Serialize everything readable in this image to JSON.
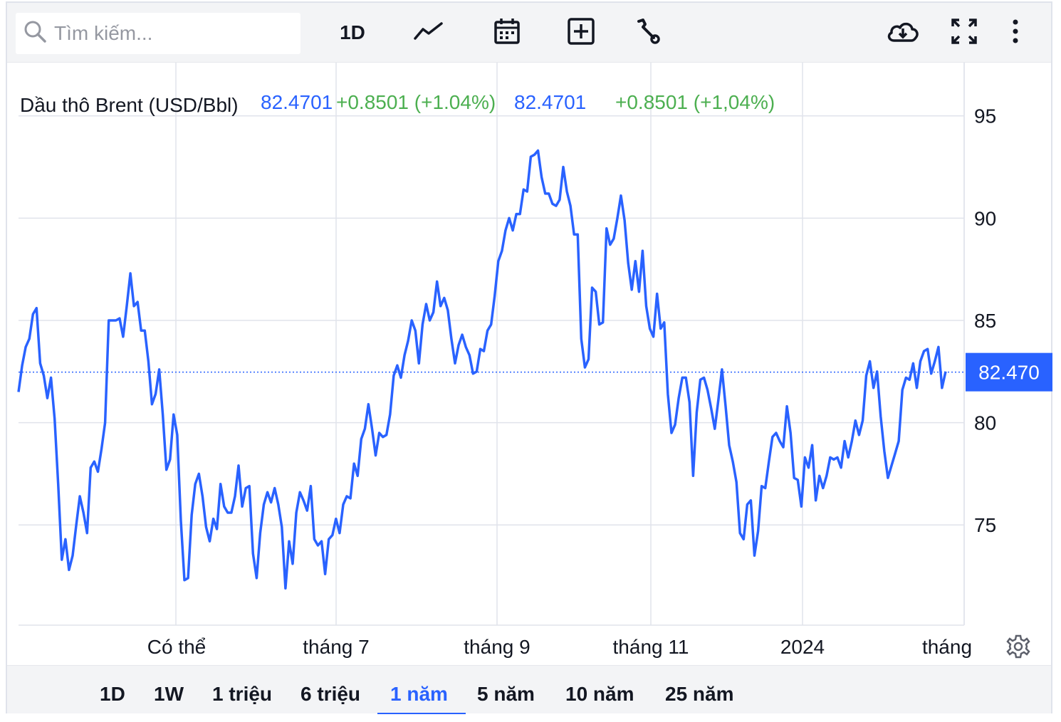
{
  "toolbar": {
    "search_placeholder": "Tìm kiếm...",
    "interval_label": "1D",
    "icons": [
      "search-icon",
      "line-chart-icon",
      "calendar-icon",
      "add-indicator-icon",
      "wrench-icon",
      "cloud-download-icon",
      "fullscreen-icon",
      "more-vertical-icon"
    ]
  },
  "legend": {
    "symbol": "Dầu thô Brent (USD/Bbl)",
    "value": "82.4701",
    "change": "+0.8501 (+1.04%)",
    "value2": "82.4701",
    "change2": "+0.8501 (+1,04%)"
  },
  "colors": {
    "line": "#2962ff",
    "positive": "#4caf50",
    "last_price_bg": "#2962ff"
  },
  "range_buttons": [
    "1D",
    "1W",
    "1 triệu",
    "6 triệu",
    "1 năm",
    "5 năm",
    "10 năm",
    "25 năm"
  ],
  "active_range": "1 năm",
  "chart_data": {
    "type": "line",
    "series_color": "#2962ff",
    "y_ticks": [
      75,
      80,
      85,
      90,
      95
    ],
    "ylim": [
      70.1,
      97.6
    ],
    "x_tick_labels": [
      "Có thể",
      "tháng 7",
      "tháng 9",
      "tháng 11",
      "2024",
      "tháng"
    ],
    "last_price_label": "82.470",
    "last_value": 82.47,
    "grid": true,
    "values": [
      81.5,
      82.8,
      83.7,
      84.1,
      85.3,
      85.6,
      82.9,
      82.3,
      81.2,
      82.2,
      80.2,
      77.0,
      73.3,
      74.3,
      72.8,
      73.5,
      75.0,
      76.4,
      75.6,
      74.6,
      77.8,
      78.1,
      77.6,
      78.7,
      80.0,
      85.0,
      85.0,
      85.0,
      85.1,
      84.2,
      85.7,
      87.3,
      85.7,
      85.9,
      84.5,
      84.5,
      83.0,
      80.9,
      81.4,
      82.6,
      80.4,
      77.7,
      78.2,
      80.4,
      79.4,
      75.2,
      72.3,
      72.4,
      75.5,
      77.0,
      77.5,
      76.4,
      74.9,
      74.2,
      75.3,
      74.8,
      77.0,
      75.9,
      75.6,
      75.6,
      76.4,
      77.9,
      75.9,
      76.8,
      76.9,
      73.6,
      72.4,
      74.6,
      76.0,
      76.6,
      76.1,
      76.8,
      76.0,
      74.9,
      71.9,
      74.2,
      73.1,
      75.6,
      76.6,
      76.2,
      75.7,
      76.9,
      74.3,
      74.0,
      74.2,
      72.6,
      74.3,
      74.5,
      75.3,
      74.6,
      76.0,
      76.4,
      76.3,
      78.0,
      77.4,
      79.2,
      79.7,
      80.9,
      79.7,
      78.4,
      79.5,
      79.3,
      79.4,
      80.4,
      82.3,
      82.8,
      82.2,
      83.3,
      84.0,
      85.0,
      84.5,
      82.9,
      84.8,
      85.8,
      85.0,
      85.4,
      86.9,
      85.7,
      86.1,
      85.5,
      84.1,
      82.9,
      83.8,
      84.3,
      83.7,
      83.3,
      82.4,
      82.5,
      83.6,
      83.5,
      84.5,
      84.8,
      86.2,
      87.9,
      88.4,
      89.4,
      90.0,
      89.4,
      90.2,
      90.2,
      91.4,
      91.3,
      93.0,
      93.1,
      93.3,
      92.0,
      91.2,
      91.2,
      90.7,
      90.6,
      90.9,
      92.5,
      91.3,
      90.6,
      89.2,
      89.2,
      84.1,
      82.7,
      83.1,
      86.6,
      86.4,
      84.8,
      84.9,
      89.5,
      88.7,
      89.0,
      90.0,
      91.1,
      89.9,
      87.8,
      86.5,
      87.9,
      86.4,
      88.4,
      85.7,
      84.6,
      84.2,
      86.3,
      84.6,
      84.9,
      81.4,
      79.5,
      79.9,
      81.2,
      82.2,
      82.2,
      81.0,
      77.4,
      80.5,
      82.1,
      82.2,
      81.6,
      80.7,
      79.7,
      81.1,
      82.6,
      80.8,
      78.9,
      78.1,
      77.1,
      74.6,
      74.3,
      76.0,
      76.2,
      73.5,
      74.7,
      76.9,
      76.8,
      78.1,
      79.3,
      79.5,
      79.1,
      78.8,
      80.8,
      79.5,
      77.3,
      77.2,
      75.9,
      78.3,
      77.8,
      78.9,
      76.2,
      77.4,
      76.8,
      77.4,
      78.3,
      78.2,
      78.3,
      77.8,
      79.1,
      78.3,
      79.1,
      80.1,
      79.4,
      80.1,
      82.3,
      83.0,
      81.7,
      82.5,
      80.3,
      78.6,
      77.3,
      77.9,
      78.5,
      79.1,
      81.6,
      82.2,
      82.1,
      82.9,
      81.7,
      83.0,
      83.5,
      83.6,
      82.4,
      83.0,
      83.7,
      81.7,
      82.5
    ]
  }
}
